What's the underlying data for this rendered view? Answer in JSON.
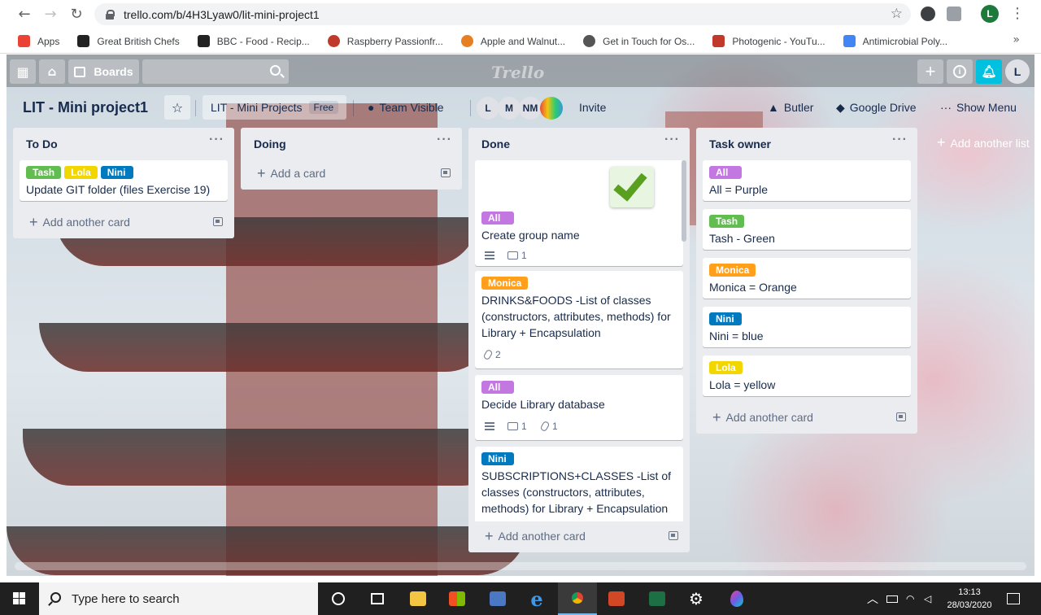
{
  "browser": {
    "url": "trello.com/b/4H3Lyaw0/lit-mini-project1",
    "profile_initial": "L",
    "bookmarks": [
      {
        "label": "Apps",
        "color": "#ea4335"
      },
      {
        "label": "Great British Chefs",
        "color": "#222222"
      },
      {
        "label": "BBC - Food - Recip...",
        "color": "#222222"
      },
      {
        "label": "Raspberry Passionfr...",
        "color": "#c0392b"
      },
      {
        "label": "Apple and Walnut...",
        "color": "#e67e22"
      },
      {
        "label": "Get in Touch for Os...",
        "color": "#555555"
      },
      {
        "label": "Photogenic - YouTu...",
        "color": "#c0392b"
      },
      {
        "label": "Antimicrobial Poly...",
        "color": "#4285f4"
      }
    ]
  },
  "trello": {
    "boards_label": "Boards",
    "logo": "Trello",
    "user_initial": "L",
    "board_title": "LIT - Mini project1",
    "team_name": "LIT - Mini Projects",
    "team_badge": "Free",
    "visibility": "Team Visible",
    "members": [
      "L",
      "M",
      "NM"
    ],
    "invite_label": "Invite",
    "butler_label": "Butler",
    "drive_label": "Google Drive",
    "menu_label": "Show Menu",
    "add_list_label": "Add another list",
    "colors": {
      "green": "#61bd4f",
      "yellow": "#f2d600",
      "orange": "#ff9f1a",
      "blue": "#0079bf",
      "purple": "#c377e0"
    },
    "lists": [
      {
        "title": "To Do",
        "add_label": "Add another card",
        "cards": [
          {
            "labels": [
              "Tash",
              "Lola",
              "Nini"
            ],
            "text": "Update GIT folder (files Exercise 19)"
          }
        ]
      },
      {
        "title": "Doing",
        "add_label": "Add a card"
      },
      {
        "title": "Done",
        "add_label": "Add another card",
        "cards": [
          {
            "labels": [
              "All"
            ],
            "text": "Create group name",
            "comments": "1"
          },
          {
            "labels": [
              "Monica"
            ],
            "text": "DRINKS&FOODS -List of classes (constructors, attributes, methods) for Library + Encapsulation",
            "attachments": "2"
          },
          {
            "labels": [
              "All"
            ],
            "text": "Decide Library database",
            "comments": "1",
            "attachments": "1"
          },
          {
            "labels": [
              "Nini"
            ],
            "text": "SUBSCRIPTIONS+CLASSES -List of classes (constructors, attributes, methods) for Library + Encapsulation"
          }
        ]
      },
      {
        "title": "Task owner",
        "add_label": "Add another card",
        "cards": [
          {
            "labels": [
              "All"
            ],
            "text": "All = Purple"
          },
          {
            "labels": [
              "Tash"
            ],
            "text": "Tash - Green"
          },
          {
            "labels": [
              "Monica"
            ],
            "text": "Monica = Orange"
          },
          {
            "labels": [
              "Nini"
            ],
            "text": "Nini = blue"
          },
          {
            "labels": [
              "Lola"
            ],
            "text": "Lola = yellow"
          }
        ]
      }
    ]
  },
  "taskbar": {
    "search_placeholder": "Type here to search",
    "time": "13:13",
    "date": "28/03/2020"
  }
}
